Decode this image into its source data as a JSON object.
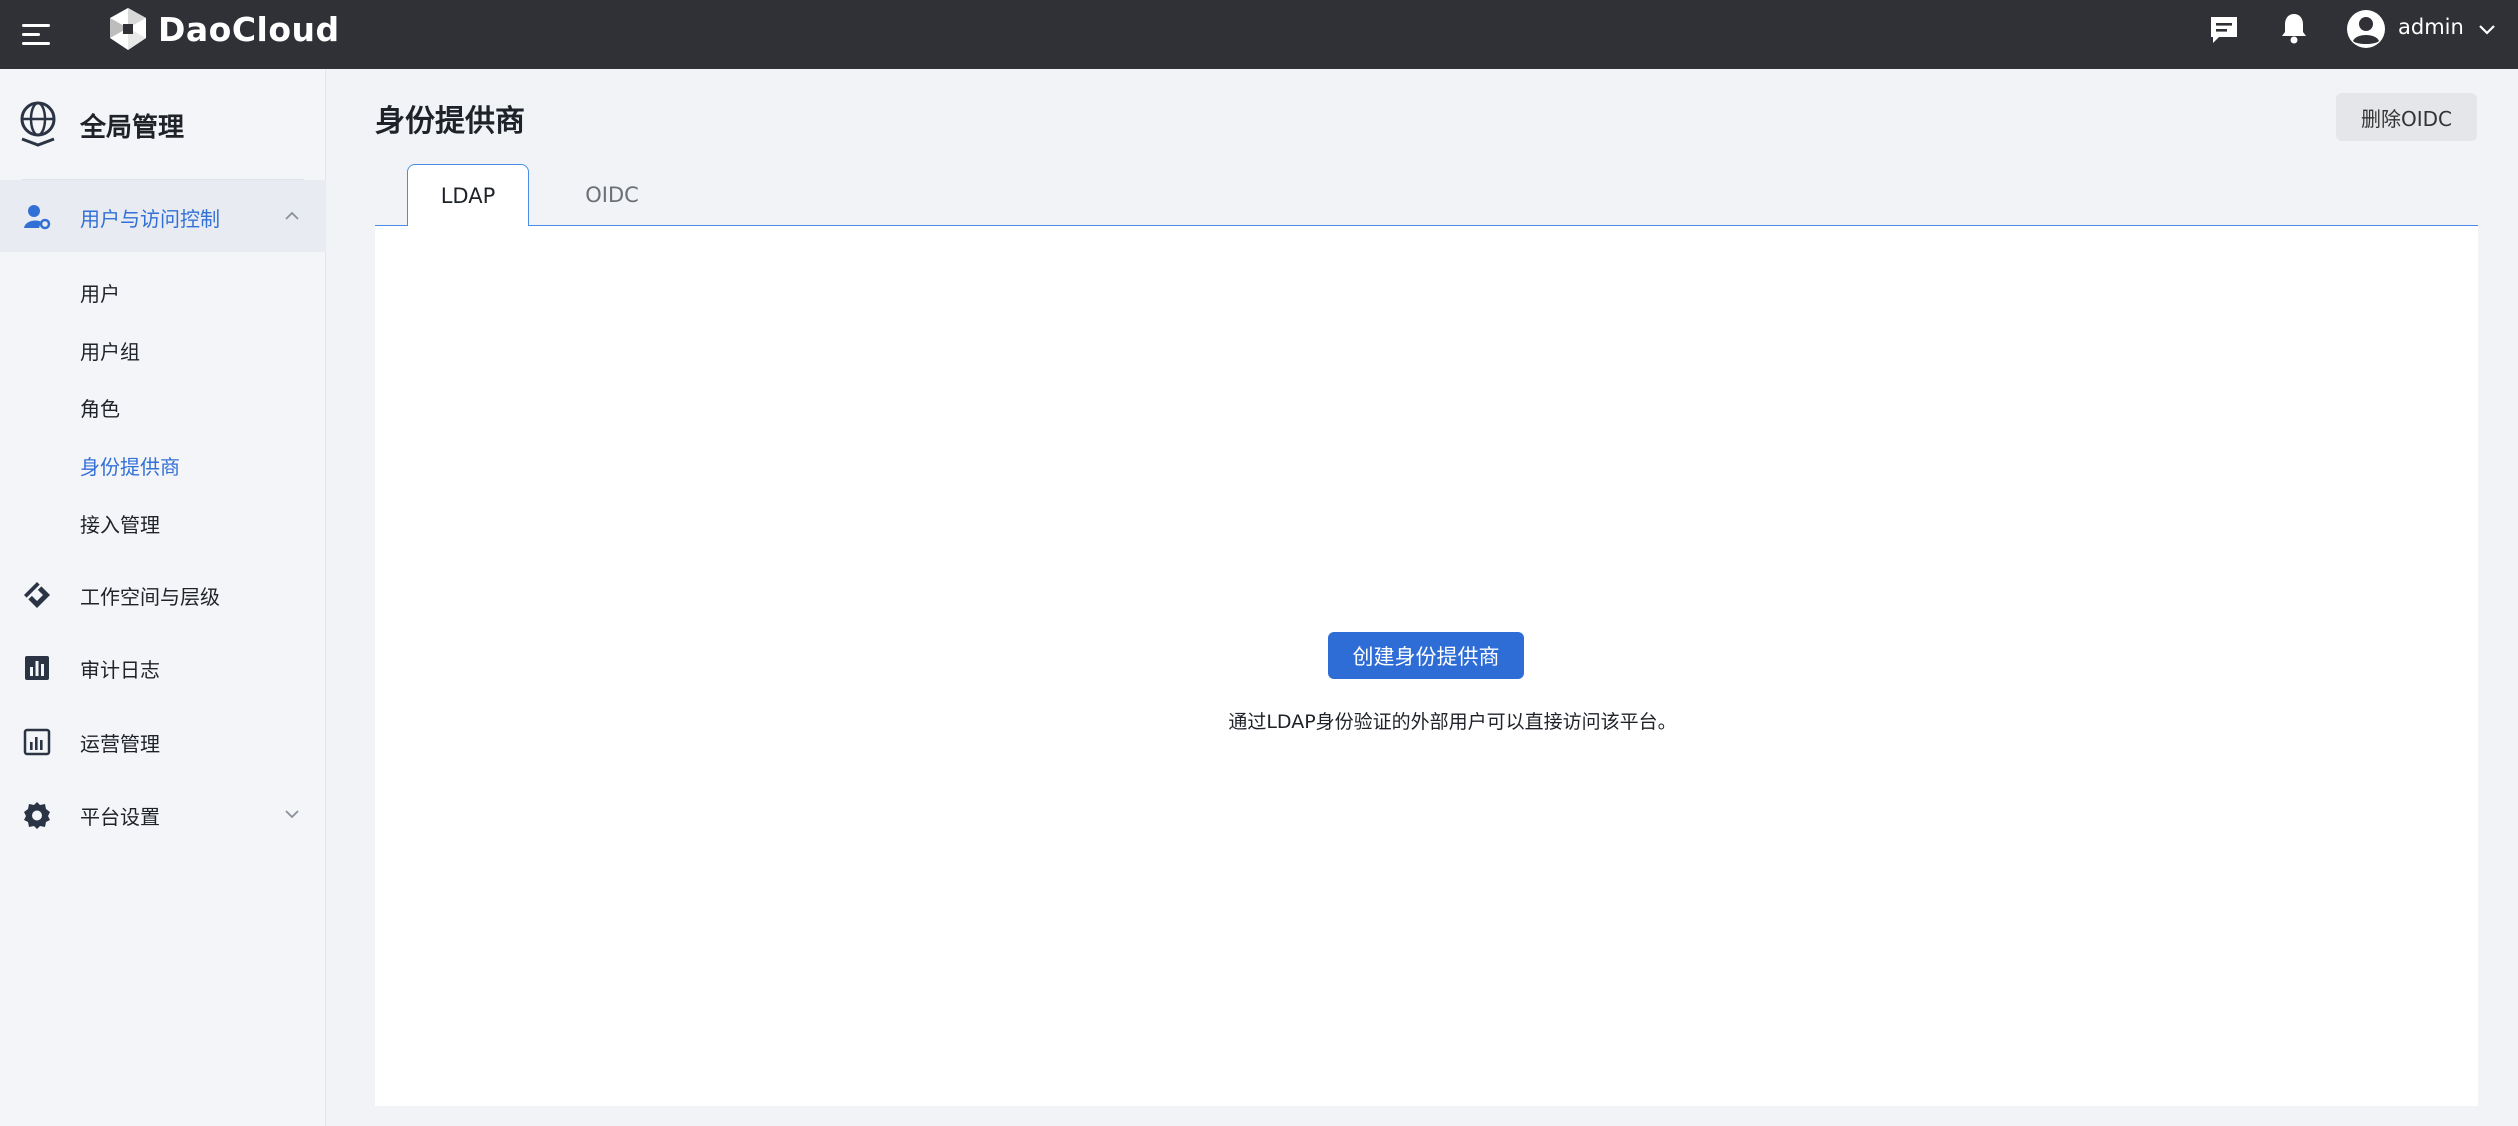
{
  "topbar": {
    "brand": "DaoCloud",
    "user": "admin",
    "icons": [
      "menu-icon",
      "message-icon",
      "bell-icon",
      "user-avatar-icon",
      "chevron-down-icon"
    ]
  },
  "sidebar": {
    "title": "全局管理",
    "groups": [
      {
        "label": "用户与访问控制",
        "icon": "user-access-icon",
        "expanded": true,
        "items": [
          {
            "label": "用户"
          },
          {
            "label": "用户组"
          },
          {
            "label": "角色"
          },
          {
            "label": "身份提供商",
            "active": true
          },
          {
            "label": "接入管理"
          }
        ]
      },
      {
        "label": "工作空间与层级",
        "icon": "workspace-icon"
      },
      {
        "label": "审计日志",
        "icon": "audit-log-icon"
      },
      {
        "label": "运营管理",
        "icon": "operations-icon"
      },
      {
        "label": "平台设置",
        "icon": "settings-icon",
        "expanded": false
      }
    ]
  },
  "main": {
    "title": "身份提供商",
    "delete_button": "删除OIDC",
    "tabs": [
      {
        "label": "LDAP",
        "active": true
      },
      {
        "label": "OIDC"
      }
    ],
    "create_button": "创建身份提供商",
    "empty_description": "通过LDAP身份验证的外部用户可以直接访问该平台。"
  },
  "colors": {
    "topbar": "#2f3136",
    "accent": "#2e6cd6",
    "active_text": "#3270d6"
  }
}
